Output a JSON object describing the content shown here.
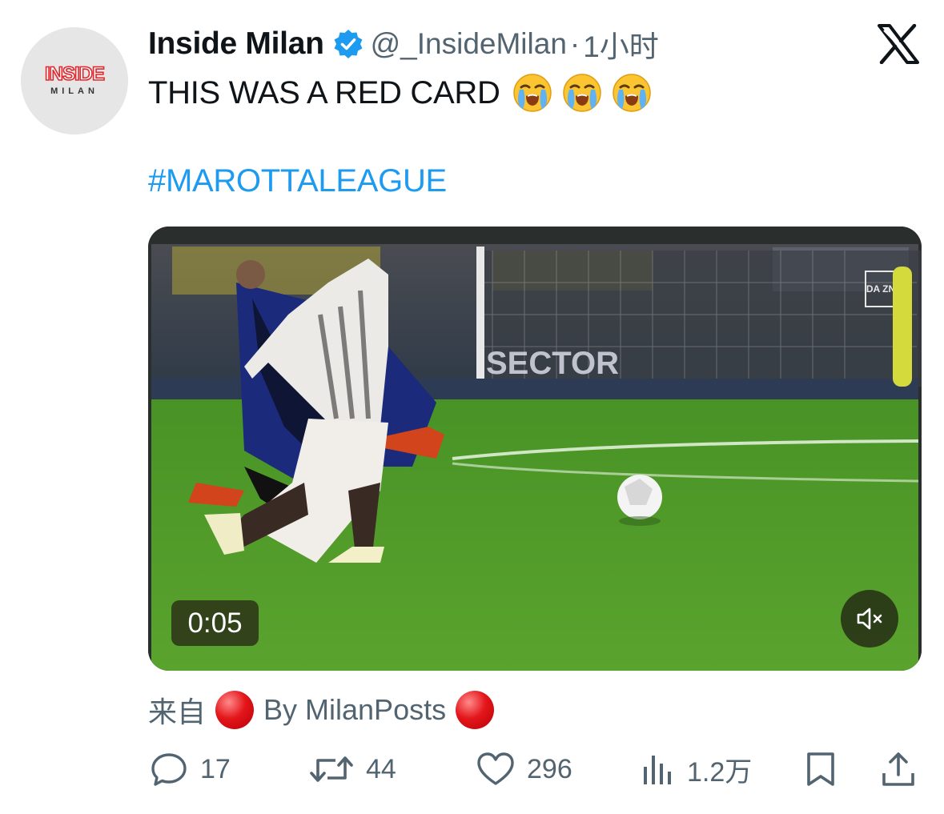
{
  "author": {
    "avatar_text_top": "INSIDE",
    "avatar_text_bottom": "MILAN",
    "display_name": "Inside Milan",
    "handle": "@_InsideMilan",
    "separator": "·",
    "time": "1小时"
  },
  "tweet": {
    "text": "THIS WAS A RED CARD",
    "emojis": [
      "loudly-crying-face",
      "loudly-crying-face",
      "loudly-crying-face"
    ],
    "hashtag": "#MAROTTALEAGUE"
  },
  "media": {
    "type": "video",
    "duration": "0:05",
    "muted": true,
    "scene_text": {
      "broadcaster": "DA ZN",
      "board": "SECTOR"
    }
  },
  "source": {
    "prefix": "来自",
    "name": "By MilanPosts"
  },
  "actions": {
    "replies": "17",
    "retweets": "44",
    "likes": "296",
    "views": "1.2万"
  },
  "colors": {
    "link": "#1d9bf0",
    "secondary_text": "#536471",
    "verified": "#1d9bf0",
    "pitch": "#4f9a2a"
  }
}
